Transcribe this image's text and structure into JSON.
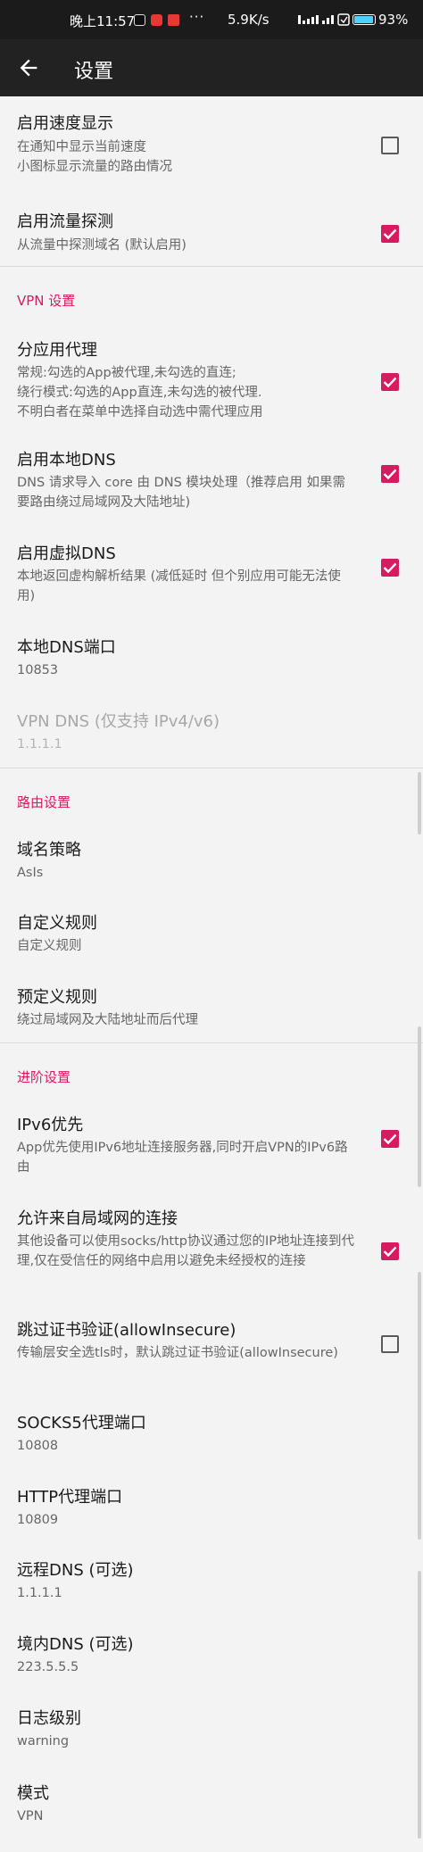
{
  "status_bar": {
    "time": "晚上11:57",
    "dots": "···",
    "net_speed": "5.9K/s",
    "battery": "93%",
    "battery_level": 0.93
  },
  "header": {
    "title": "设置"
  },
  "items": [
    {
      "title": "启用速度显示",
      "summary": "在通知中显示当前速度\n小图标显示流量的路由情况",
      "checkbox": false
    },
    {
      "title": "启用流量探测",
      "summary": "从流量中探测域名 (默认启用)",
      "checkbox": true
    },
    {
      "title": "分应用代理",
      "summary": "常规:勾选的App被代理,未勾选的直连;\n绕行模式:勾选的App直连,未勾选的被代理.\n不明白者在菜单中选择自动选中需代理应用",
      "checkbox": true
    },
    {
      "title": "启用本地DNS",
      "summary": "DNS 请求导入 core 由 DNS 模块处理（推荐启用 如果需要路由绕过局域网及大陆地址)",
      "checkbox": true
    },
    {
      "title": "启用虚拟DNS",
      "summary": "本地返回虚构解析结果 (减低延时 但个别应用可能无法使用)",
      "checkbox": true
    },
    {
      "title": "本地DNS端口",
      "summary": "10853"
    },
    {
      "title": "VPN DNS (仅支持 IPv4/v6)",
      "summary": "1.1.1.1",
      "disabled": true
    },
    {
      "title": "域名策略",
      "summary": "AsIs"
    },
    {
      "title": "自定义规则",
      "summary": "自定义规则"
    },
    {
      "title": "预定义规则",
      "summary": "绕过局域网及大陆地址而后代理"
    },
    {
      "title": "IPv6优先",
      "summary": "App优先使用IPv6地址连接服务器,同时开启VPN的IPv6路由",
      "checkbox": true
    },
    {
      "title": "允许来自局域网的连接",
      "summary": "其他设备可以使用socks/http协议通过您的IP地址连接到代理,仅在受信任的网络中启用以避免未经授权的连接",
      "checkbox": true
    },
    {
      "title": "跳过证书验证(allowInsecure)",
      "summary": "传输层安全选tls时，默认跳过证书验证(allowInsecure)",
      "checkbox": false
    },
    {
      "title": "SOCKS5代理端口",
      "summary": "10808"
    },
    {
      "title": "HTTP代理端口",
      "summary": "10809"
    },
    {
      "title": "远程DNS (可选)",
      "summary": "1.1.1.1"
    },
    {
      "title": "境内DNS (可选)",
      "summary": "223.5.5.5"
    },
    {
      "title": "日志级别",
      "summary": "warning"
    },
    {
      "title": "模式",
      "summary": "VPN"
    }
  ],
  "sections": {
    "vpn": "VPN 设置",
    "routing": "路由设置",
    "advanced": "进阶设置"
  },
  "colors": {
    "accent": "#d81b60",
    "appbar": "#222222",
    "statusbar": "#1b1b1b",
    "background": "#f3f3f3"
  }
}
